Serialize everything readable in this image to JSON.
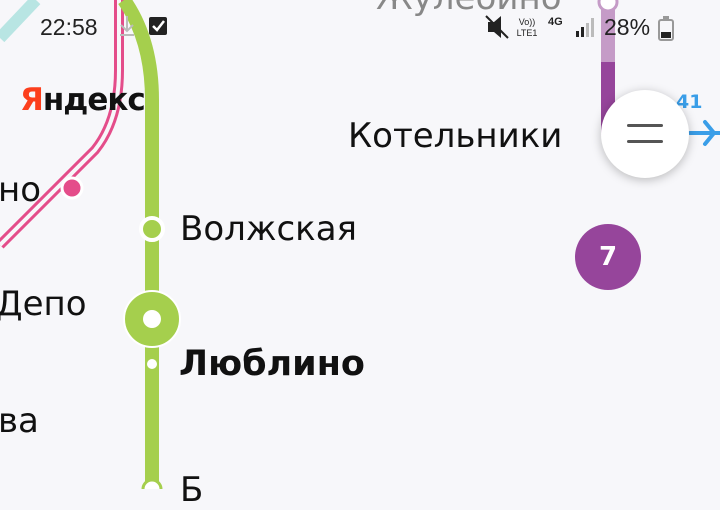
{
  "status_bar": {
    "time": "22:58",
    "battery_percent": "28%",
    "volte_label": "Vo)) LTE1",
    "network_label": "4G",
    "icons": [
      "download-icon",
      "checkbox-notification-icon",
      "mute-icon",
      "volte-icon",
      "4g-icon",
      "signal-icon",
      "battery-icon"
    ]
  },
  "logo": {
    "first_letter": "Я",
    "rest": "ндекс"
  },
  "stations": {
    "top_partial": "Жулебино",
    "kotelniki": "Котельники",
    "volzhskaya": "Волжская",
    "lyublino": "Люблино",
    "depo": "Депо",
    "left_partial_no": "но",
    "left_partial_va": "ва",
    "bottom_partial": "Б"
  },
  "line_badge": {
    "number": "7",
    "color": "#96459b"
  },
  "airport_label": "41",
  "colors": {
    "lime_line": "#a5cf4d",
    "purple_line": "#96459b",
    "pink_line": "#e44d8a",
    "teal_line": "#b8e5e3",
    "airport_blue": "#3a9ee8"
  }
}
